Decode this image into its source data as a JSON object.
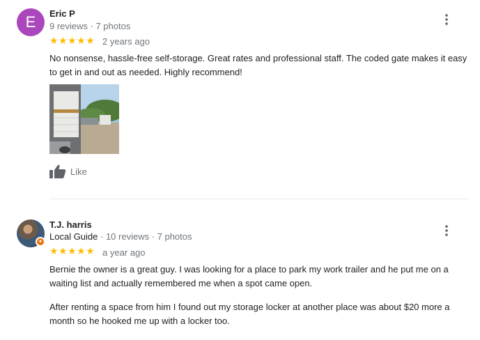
{
  "reviews": [
    {
      "avatar_letter": "E",
      "avatar_color": "#ab47bc",
      "name": "Eric P",
      "meta": "9 reviews · 7 photos",
      "rating": 5,
      "stars": "★★★★★",
      "when": "2 years ago",
      "text": "No nonsense, hassle-free self-storage. Great rates and professional staff. The coded gate makes it easy to get in and out as needed. Highly recommend!",
      "photos": 1,
      "like_label": "Like",
      "more_icon": "more-vert-icon"
    },
    {
      "name": "T.J. harris",
      "guide_label": "Local Guide",
      "meta_counts": " · 10 reviews · 7 photos",
      "rating": 5,
      "stars": "★★★★★",
      "when": "a year ago",
      "text_p1": "Bernie the owner is a great guy. I was looking for a place to park my work trailer and he put me on a waiting list and actually remembered me when a spot came open.",
      "text_p2": "After renting a space from him I found out my storage locker at another place was about $20 more a month so he hooked me up with a locker too.",
      "more_icon": "more-vert-icon"
    }
  ],
  "colors": {
    "star": "#fbbc04",
    "guide_badge": "#e8710a",
    "secondary_text": "#70757a"
  }
}
